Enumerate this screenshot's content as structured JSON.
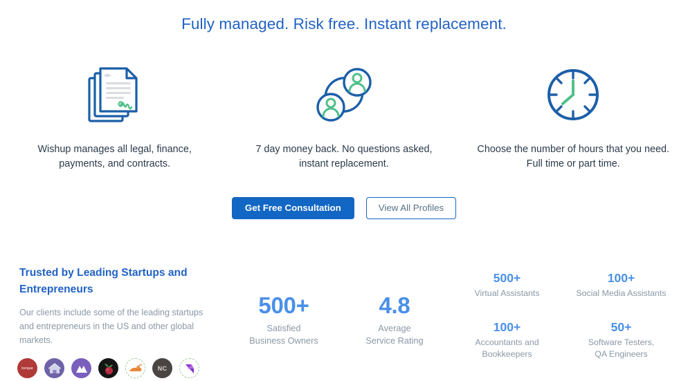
{
  "hero": {
    "heading": "Fully managed. Risk free. Instant replacement."
  },
  "features": [
    {
      "icon": "documents-contract-icon",
      "text": "Wishup manages all legal, finance, payments, and contracts."
    },
    {
      "icon": "user-replacement-icon",
      "text": "7 day money back. No questions asked, instant replacement."
    },
    {
      "icon": "clock-icon",
      "text": "Choose the number of hours that you need. Full time or part time."
    }
  ],
  "cta": {
    "primary_label": "Get Free Consultation",
    "secondary_label": "View All Profiles",
    "primary_color": "#1266c4",
    "secondary_border_color": "#1266c4"
  },
  "trusted": {
    "title": "Trusted by Leading Startups and Entrepreneurs",
    "body": "Our clients include some of the leading startups and entrepreneurs in the US and other global markets.",
    "title_color": "#2262c6",
    "logos": [
      {
        "name": "client-logo-torque",
        "label": "torque",
        "bg": "#b03a38"
      },
      {
        "name": "client-logo-house",
        "label": "",
        "bg": "#6e62a8"
      },
      {
        "name": "client-logo-mountain",
        "label": "",
        "bg": "#7a5fbd"
      },
      {
        "name": "client-logo-berry",
        "label": "",
        "bg": "#151515"
      },
      {
        "name": "client-logo-rabbit",
        "label": "",
        "bg": "#ffffff"
      },
      {
        "name": "client-logo-nc",
        "label": "NC",
        "bg": "#4a4442"
      },
      {
        "name": "client-logo-arrow",
        "label": "",
        "bg": "#ffffff"
      }
    ]
  },
  "big_stats": [
    {
      "value": "500+",
      "label_line1": "Satisfied",
      "label_line2": "Business Owners"
    },
    {
      "value": "4.8",
      "label_line1": "Average",
      "label_line2": "Service Rating"
    }
  ],
  "small_stats": [
    {
      "value": "500+",
      "label_line1": "Virtual Assistants",
      "label_line2": ""
    },
    {
      "value": "100+",
      "label_line1": "Social Media Assistants",
      "label_line2": ""
    },
    {
      "value": "100+",
      "label_line1": "Accountants and",
      "label_line2": "Bookkeepers"
    },
    {
      "value": "50+",
      "label_line1": "Software Testers,",
      "label_line2": "QA Engineers"
    }
  ],
  "colors": {
    "accent_blue": "#2262c6",
    "stat_blue": "#4a90e8",
    "icon_blue": "#1c5fa8",
    "icon_green": "#4fc08a",
    "muted_text": "#8a98a6",
    "body_text": "#2b3a4a"
  }
}
